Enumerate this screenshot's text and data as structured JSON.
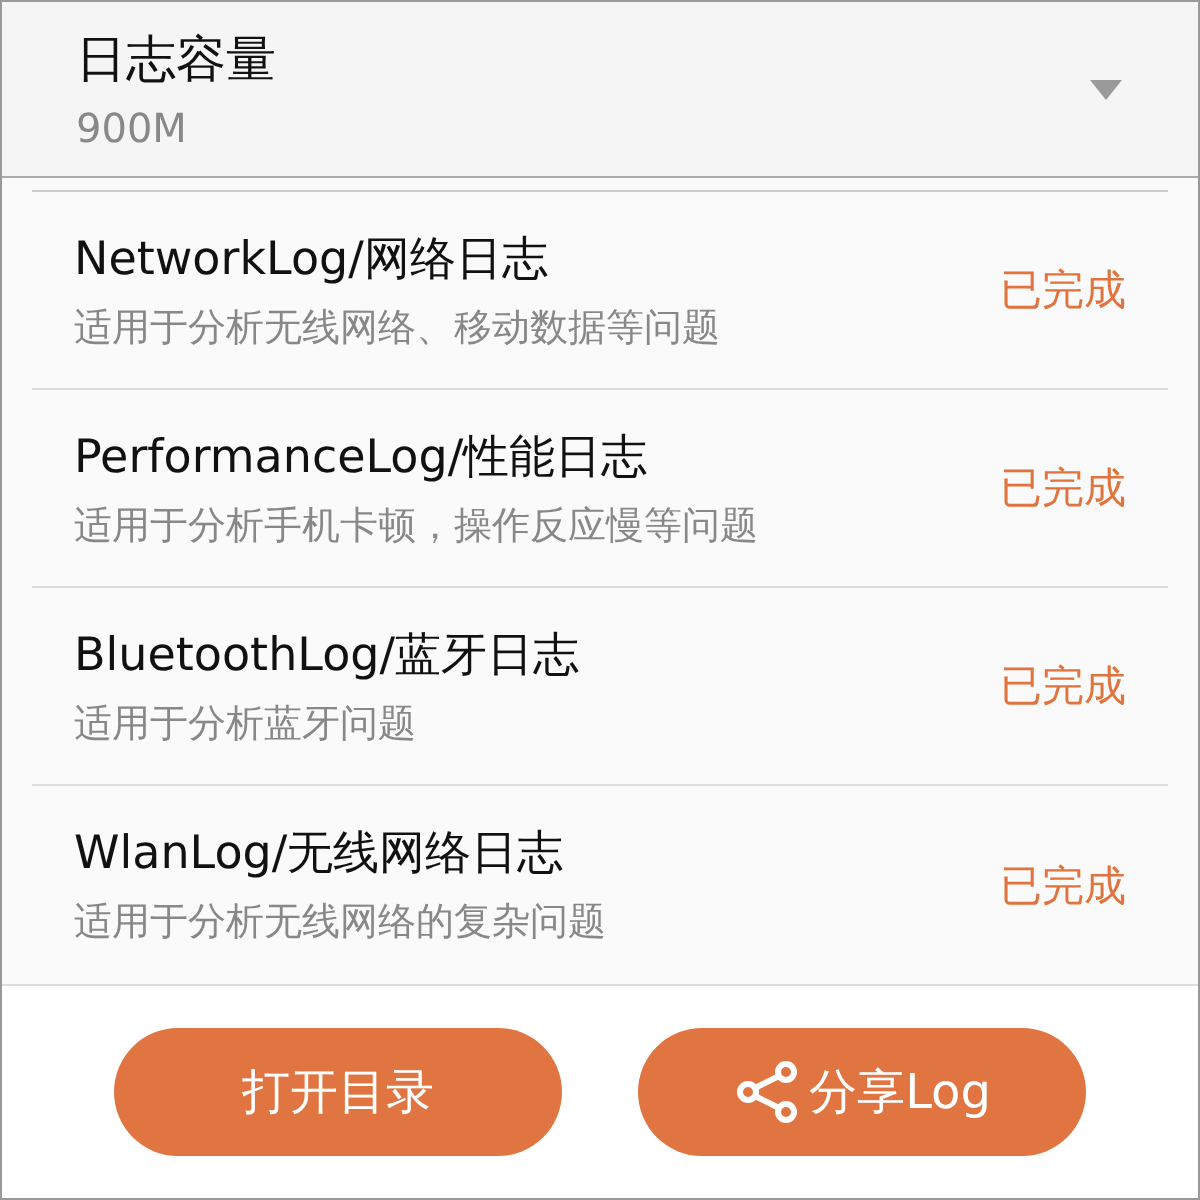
{
  "capacity": {
    "label": "日志容量",
    "value": "900M"
  },
  "logs": [
    {
      "title": "NetworkLog/网络日志",
      "description": "适用于分析无线网络、移动数据等问题",
      "status": "已完成"
    },
    {
      "title": "PerformanceLog/性能日志",
      "description": "适用于分析手机卡顿，操作反应慢等问题",
      "status": "已完成"
    },
    {
      "title": "BluetoothLog/蓝牙日志",
      "description": "适用于分析蓝牙问题",
      "status": "已完成"
    },
    {
      "title": "WlanLog/无线网络日志",
      "description": "适用于分析无线网络的复杂问题",
      "status": "已完成"
    }
  ],
  "buttons": [
    {
      "label": "打开目录",
      "kind": "plain"
    },
    {
      "label": "分享Log",
      "kind": "share"
    }
  ]
}
